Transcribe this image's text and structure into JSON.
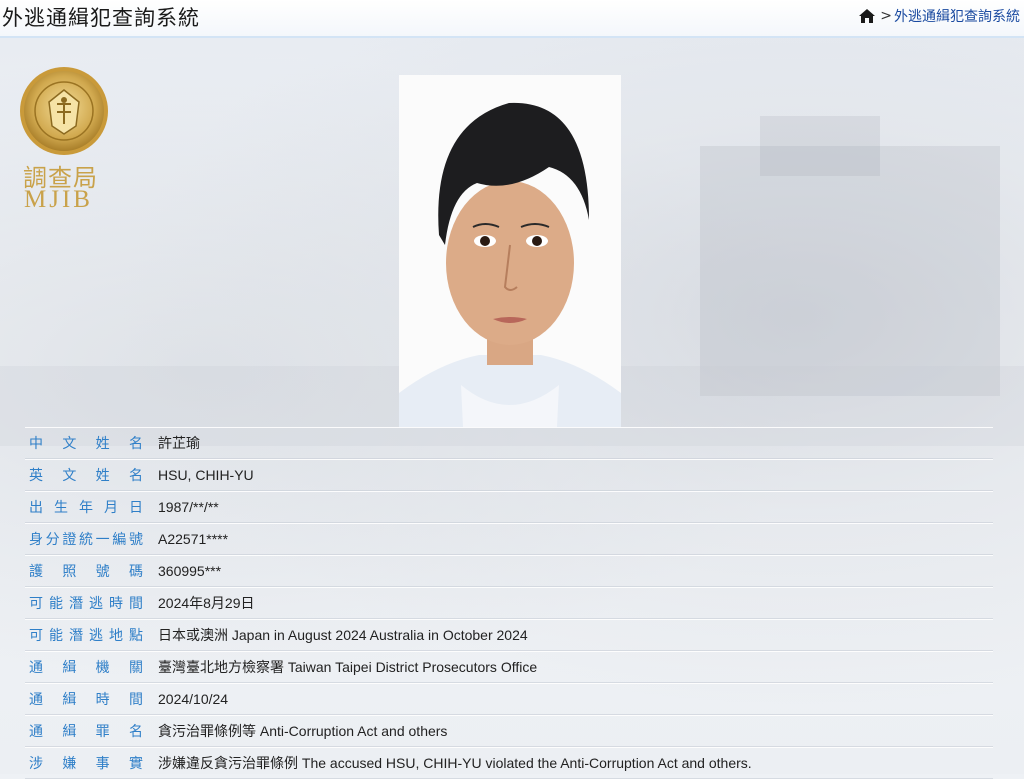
{
  "header": {
    "title": "外逃通緝犯查詢系統",
    "breadcrumb": [
      {
        "icon": "home-icon"
      },
      {
        "separator": ">"
      },
      {
        "label": "外逃通緝犯查詢系統"
      }
    ]
  },
  "logo": {
    "seal_icon": "mjib-seal-icon",
    "text_cn": "調查局",
    "text_en": "MJIB"
  },
  "profile": {
    "photo_alt": "suspect-photo",
    "fields": [
      {
        "label": [
          "中",
          "文",
          "姓",
          "名"
        ],
        "value": "許芷瑜"
      },
      {
        "label": [
          "英",
          "文",
          "姓",
          "名"
        ],
        "value": "HSU, CHIH-YU"
      },
      {
        "label": [
          "出",
          "生",
          "年",
          "月",
          "日"
        ],
        "value": "1987/**/**"
      },
      {
        "label": [
          "身",
          "分",
          "證",
          "統",
          "一",
          "編",
          "號"
        ],
        "value": "A22571****"
      },
      {
        "label": [
          "護",
          "照",
          "號",
          "碼"
        ],
        "value": "360995***"
      },
      {
        "label": [
          "可",
          "能",
          "潛",
          "逃",
          "時",
          "間"
        ],
        "value": "2024年8月29日"
      },
      {
        "label": [
          "可",
          "能",
          "潛",
          "逃",
          "地",
          "點"
        ],
        "value": "日本或澳洲 Japan in August 2024 Australia in October 2024"
      },
      {
        "label": [
          "通",
          "緝",
          "機",
          "關"
        ],
        "value": "臺灣臺北地方檢察署 Taiwan Taipei District Prosecutors Office"
      },
      {
        "label": [
          "通",
          "緝",
          "時",
          "間"
        ],
        "value": "2024/10/24"
      },
      {
        "label": [
          "通",
          "緝",
          "罪",
          "名"
        ],
        "value": "貪污治罪條例等 Anti-Corruption Act and others"
      },
      {
        "label": [
          "涉",
          "嫌",
          "事",
          "實"
        ],
        "value": "涉嫌違反貪污治罪條例 The accused HSU, CHIH-YU violated the Anti-Corruption Act and others."
      }
    ]
  },
  "colors": {
    "label": "#2f7fc8",
    "link": "#1a4aa0",
    "header_border": "#d3e4f5",
    "logo_gold": "#c9a24a"
  }
}
